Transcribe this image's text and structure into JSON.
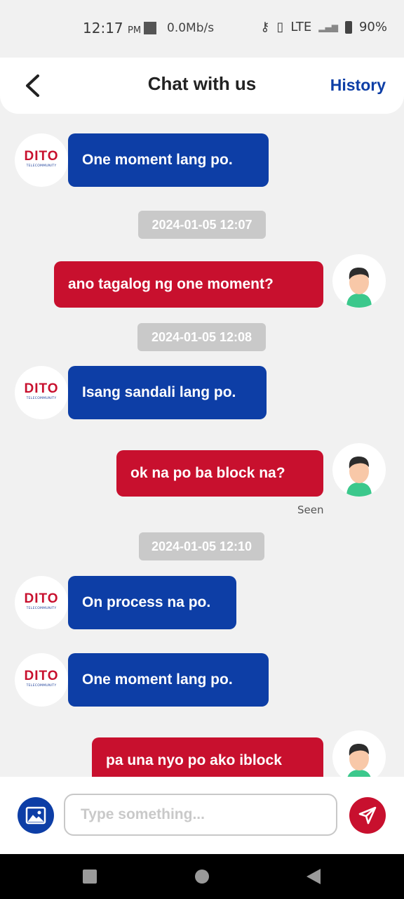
{
  "status_bar": {
    "time": "12:17",
    "ampm": "PM",
    "speed": "0.0Mb/s",
    "network": "LTE",
    "battery": "90%"
  },
  "header": {
    "title": "Chat with us",
    "history_label": "History"
  },
  "agent_logo": {
    "word": "DITO",
    "sub": "TELECOMMUNITY"
  },
  "messages": [
    {
      "sender": "agent",
      "text": "One moment lang po."
    },
    {
      "timestamp": "2024-01-05 12:07"
    },
    {
      "sender": "user",
      "text": "ano tagalog ng one moment?"
    },
    {
      "timestamp": "2024-01-05 12:08"
    },
    {
      "sender": "agent",
      "text": "Isang sandali lang po."
    },
    {
      "sender": "user",
      "text": "ok na po ba block na?",
      "status": "Seen"
    },
    {
      "timestamp": "2024-01-05 12:10"
    },
    {
      "sender": "agent",
      "text": "On process na po."
    },
    {
      "sender": "agent",
      "text": "One moment lang po."
    },
    {
      "sender": "user",
      "text": "pa una nyo po ako iblock"
    }
  ],
  "input": {
    "placeholder": "Type something...",
    "value": ""
  },
  "colors": {
    "agent_bubble": "#0d3ea6",
    "user_bubble": "#c8102e",
    "timestamp_bg": "#c9c9c9",
    "background": "#f1f1f1"
  }
}
